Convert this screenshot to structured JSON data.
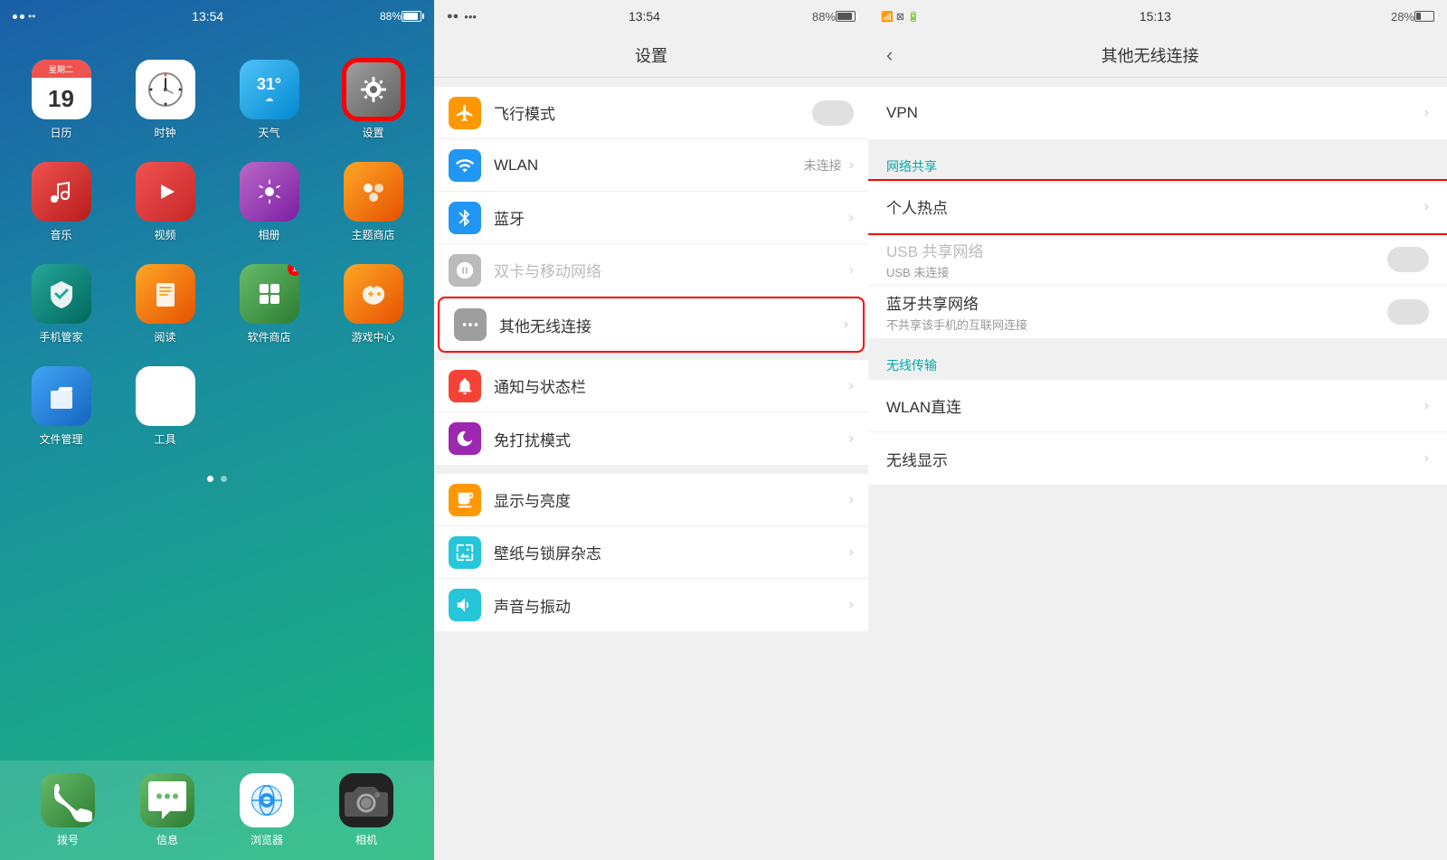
{
  "home": {
    "status": {
      "dots": 2,
      "time": "13:54",
      "battery": "88%"
    },
    "apps": [
      {
        "id": "calendar",
        "label": "日历",
        "icon_type": "calendar",
        "text": "19",
        "subtext": "星期二"
      },
      {
        "id": "clock",
        "label": "时钟",
        "icon_type": "clock"
      },
      {
        "id": "weather",
        "label": "天气",
        "icon_type": "weather",
        "text": "31°"
      },
      {
        "id": "settings",
        "label": "设置",
        "icon_type": "settings",
        "highlighted": true
      },
      {
        "id": "music",
        "label": "音乐",
        "icon_type": "music"
      },
      {
        "id": "video",
        "label": "视频",
        "icon_type": "video"
      },
      {
        "id": "photos",
        "label": "相册",
        "icon_type": "photos"
      },
      {
        "id": "theme",
        "label": "主题商店",
        "icon_type": "theme"
      },
      {
        "id": "security",
        "label": "手机管家",
        "icon_type": "security"
      },
      {
        "id": "read",
        "label": "阅读",
        "icon_type": "read"
      },
      {
        "id": "appstore",
        "label": "软件商店",
        "icon_type": "appstore",
        "badge": "1"
      },
      {
        "id": "game",
        "label": "游戏中心",
        "icon_type": "game"
      },
      {
        "id": "files",
        "label": "文件管理",
        "icon_type": "files"
      },
      {
        "id": "tools",
        "label": "工具",
        "icon_type": "tools"
      }
    ],
    "dock": [
      {
        "id": "phone",
        "label": "拨号",
        "icon_type": "phone"
      },
      {
        "id": "sms",
        "label": "信息",
        "icon_type": "sms"
      },
      {
        "id": "browser",
        "label": "浏览器",
        "icon_type": "browser"
      },
      {
        "id": "camera",
        "label": "相机",
        "icon_type": "camera"
      }
    ]
  },
  "settings": {
    "status": {
      "dots": 2,
      "time": "13:54",
      "battery": "88%"
    },
    "title": "设置",
    "sections": [
      {
        "rows": [
          {
            "id": "flight",
            "label": "飞行模式",
            "icon_color": "#ff9800",
            "toggle": true,
            "toggle_on": false
          },
          {
            "id": "wlan",
            "label": "WLAN",
            "icon_color": "#2196f3",
            "right_text": "未连接",
            "chevron": true
          },
          {
            "id": "bluetooth",
            "label": "蓝牙",
            "icon_color": "#2196f3",
            "chevron": true
          },
          {
            "id": "sim",
            "label": "双卡与移动网络",
            "icon_color": "#4caf50",
            "chevron": true,
            "disabled": true
          },
          {
            "id": "other",
            "label": "其他无线连接",
            "icon_color": "#9e9e9e",
            "chevron": true,
            "highlighted": true
          }
        ]
      },
      {
        "rows": [
          {
            "id": "notify",
            "label": "通知与状态栏",
            "icon_color": "#f44336",
            "chevron": true
          },
          {
            "id": "dnd",
            "label": "免打扰模式",
            "icon_color": "#9c27b0",
            "chevron": true
          }
        ]
      },
      {
        "rows": [
          {
            "id": "display",
            "label": "显示与亮度",
            "icon_color": "#ff9800",
            "chevron": true
          },
          {
            "id": "wallpaper",
            "label": "壁纸与锁屏杂志",
            "icon_color": "#26c6da",
            "chevron": true
          },
          {
            "id": "sound",
            "label": "声音与振动",
            "icon_color": "#26c6da",
            "chevron": true
          }
        ]
      }
    ]
  },
  "wireless": {
    "status": {
      "time": "15:13",
      "battery": "28%"
    },
    "title": "其他无线连接",
    "sections": [
      {
        "rows": [
          {
            "id": "vpn",
            "label": "VPN",
            "chevron": true
          }
        ]
      },
      {
        "label": "网络共享",
        "label_color": "#0aa",
        "rows": [
          {
            "id": "hotspot",
            "label": "个人热点",
            "chevron": true,
            "highlighted": true
          },
          {
            "id": "usb",
            "label": "USB 共享网络",
            "sublabel": "USB 未连接",
            "toggle": true,
            "disabled": true
          },
          {
            "id": "bt_share",
            "label": "蓝牙共享网络",
            "sublabel": "不共享该手机的互联网连接",
            "toggle": true
          }
        ]
      },
      {
        "label": "无线传输",
        "label_color": "#0aa",
        "rows": [
          {
            "id": "wlan_direct",
            "label": "WLAN直连",
            "chevron": true
          },
          {
            "id": "wireless_display",
            "label": "无线显示",
            "chevron": true
          }
        ]
      }
    ]
  }
}
